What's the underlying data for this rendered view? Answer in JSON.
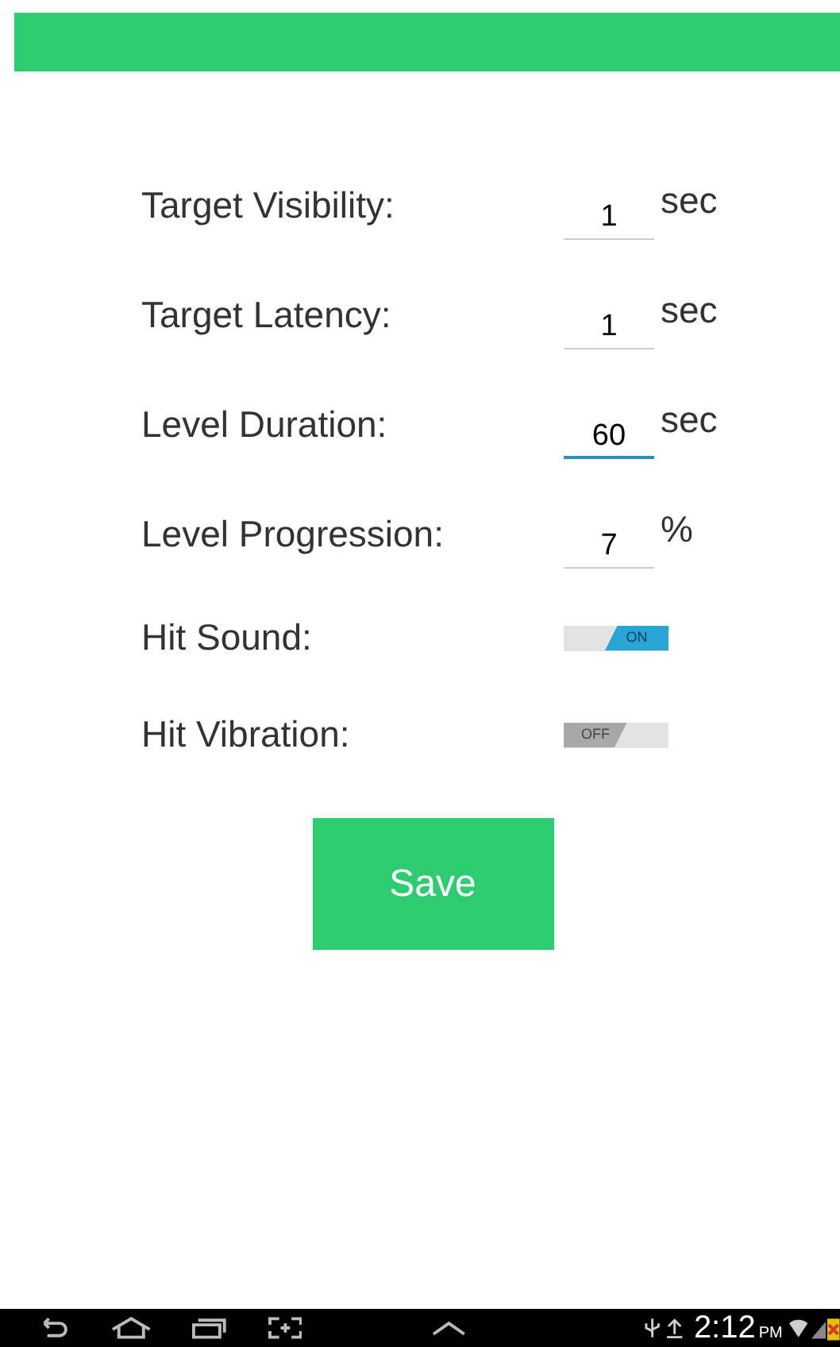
{
  "settings": [
    {
      "kind": "field",
      "label": "Target Visibility:",
      "value": "1",
      "unit": "sec",
      "focused": false
    },
    {
      "kind": "field",
      "label": "Target Latency:",
      "value": "1",
      "unit": "sec",
      "focused": false
    },
    {
      "kind": "field",
      "label": "Level Duration:",
      "value": "60",
      "unit": "sec",
      "focused": true
    },
    {
      "kind": "field",
      "label": "Level Progression:",
      "value": "7",
      "unit": "%",
      "focused": false
    },
    {
      "kind": "switch",
      "label": "Hit Sound:",
      "on": true,
      "state_text": "ON"
    },
    {
      "kind": "switch",
      "label": "Hit Vibration:",
      "on": false,
      "state_text": "OFF"
    }
  ],
  "save_button": "Save",
  "status_bar": {
    "time": "2:12",
    "ampm": "PM"
  }
}
